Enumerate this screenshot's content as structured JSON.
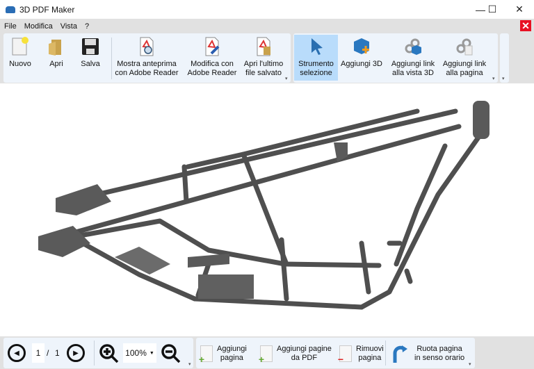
{
  "window": {
    "title": "3D PDF Maker",
    "minimize": "—",
    "maximize": "☐",
    "close": "✕"
  },
  "menu": [
    "File",
    "Modifica",
    "Vista",
    "?"
  ],
  "close_doc": "✕",
  "toolbar": {
    "file": [
      {
        "label": "Nuovo"
      },
      {
        "label": "Apri"
      },
      {
        "label": "Salva"
      }
    ],
    "reader": [
      {
        "label": "Mostra anteprima\ncon Adobe Reader"
      },
      {
        "label": "Modifica con\nAdobe Reader"
      },
      {
        "label": "Apri l'ultimo\nfile salvato"
      }
    ],
    "tools": [
      {
        "label": "Strumento\nselezione",
        "active": true
      },
      {
        "label": "Aggiungi 3D"
      },
      {
        "label": "Aggiungi link\nalla vista 3D"
      },
      {
        "label": "Aggiungi link\nalla pagina"
      }
    ]
  },
  "navigation": {
    "current_page": "1",
    "separator": "/",
    "total_pages": "1",
    "zoom": "100%"
  },
  "pages": [
    {
      "label": "Aggiungi\npagina"
    },
    {
      "label": "Aggiungi pagine\nda PDF"
    },
    {
      "label": "Rimuovi\npagina"
    },
    {
      "label": "Ruota pagina\nin senso orario"
    }
  ],
  "colors": {
    "accent": "#b9dcfb",
    "frame": "#4f4f4f",
    "toolbar_bg": "#eef4fb"
  }
}
